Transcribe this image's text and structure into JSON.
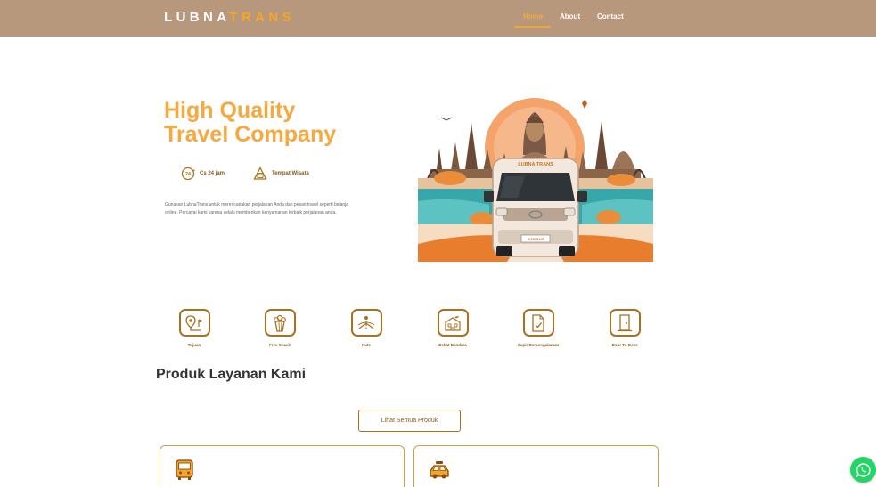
{
  "nav": {
    "logo_part1": "LUBNA",
    "logo_part2": "TRANS",
    "links": [
      {
        "label": "Home",
        "active": true
      },
      {
        "label": "About",
        "active": false
      },
      {
        "label": "Contact",
        "active": false
      }
    ]
  },
  "hero": {
    "title_line1": "High Quality",
    "title_line2": "Travel Company",
    "features": [
      {
        "label": "Cs 24 jam",
        "icon": "clock-24-icon"
      },
      {
        "label": "Tempat Wisata",
        "icon": "temple-icon"
      }
    ],
    "description": "Gunakan LubnaTrans untuk merencanakan perjalanan Anda dan pesan travel seperti belanja online. Percayai kami karena selalu memberikan kenyamanan terbaik perjalanan anda.",
    "image": {
      "van_label": "LUBNA TRANS",
      "plate": "B 1975 LR"
    }
  },
  "services": [
    {
      "label": "Tujuan",
      "icon": "map-pin-icon"
    },
    {
      "label": "Free Snack",
      "icon": "popcorn-icon"
    },
    {
      "label": "Rute",
      "icon": "route-icon"
    },
    {
      "label": "Dekat Bandara",
      "icon": "airport-icon"
    },
    {
      "label": "Supir Berpengalaman",
      "icon": "document-check-icon"
    },
    {
      "label": "Door To Door",
      "icon": "door-icon"
    }
  ],
  "products": {
    "title": "Produk Layanan Kami",
    "view_all_label": "Lihat Semua Produk"
  },
  "colors": {
    "navbar": "#b8987d",
    "accent": "#f5a623",
    "brown": "#a9701f",
    "whatsapp": "#25d366"
  }
}
